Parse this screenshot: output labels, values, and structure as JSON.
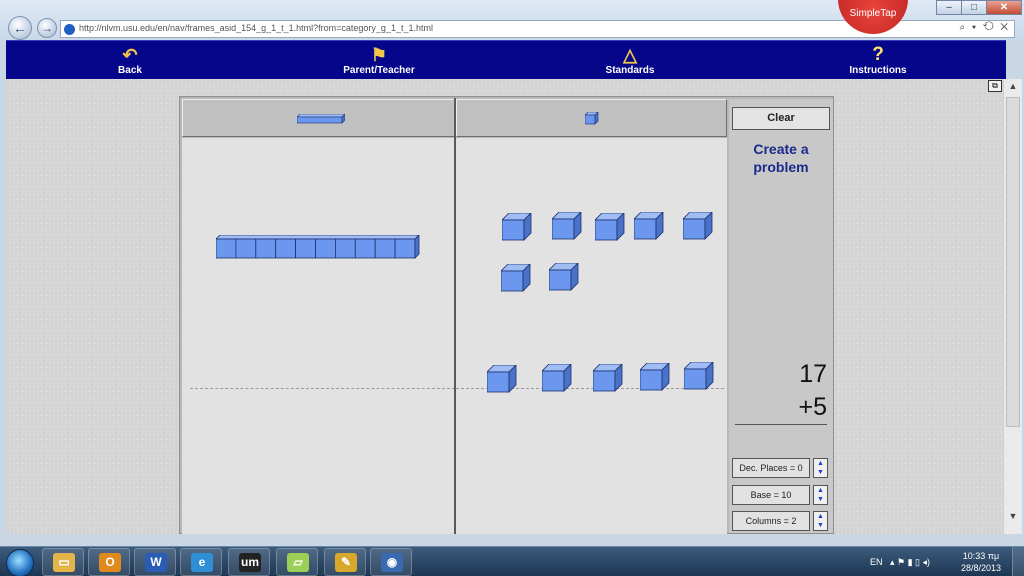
{
  "browser": {
    "url": "http://nlvm.usu.edu/en/nav/frames_asid_154_g_1_t_1.html?from=category_g_1_t_1.html",
    "toolbar_label": "SimpleTap",
    "url_tools": "⌕ ▾ ⟲ ✕",
    "window_controls": {
      "min": "–",
      "max": "□",
      "close": "✕"
    },
    "nav": {
      "back": "←",
      "forward": "→"
    }
  },
  "site_nav": {
    "back": {
      "label": "Back",
      "icon": "↶"
    },
    "parent_teacher": {
      "label": "Parent/Teacher",
      "icon": "⚑"
    },
    "standards": {
      "label": "Standards",
      "icon": "△"
    },
    "instructions": {
      "label": "Instructions",
      "icon": "?"
    }
  },
  "applet": {
    "clear_label": "Clear",
    "create_problem": "Create a problem",
    "addend1": "17",
    "addend2": "+5",
    "options": [
      {
        "label": "Dec. Places = 0"
      },
      {
        "label": "Base = 10"
      },
      {
        "label": "Columns = 2"
      }
    ],
    "stepper": {
      "up": "▲",
      "down": "▼"
    },
    "blocks": {
      "top_tens_rods": 1,
      "top_ones_cubes": 7,
      "bottom_ones_cubes": 5,
      "block_color": "#6b98ee",
      "block_edge": "#1c2f6e"
    }
  },
  "taskbar": {
    "apps": [
      {
        "name": "explorer",
        "glyph": "▭",
        "color": "#e3b54a"
      },
      {
        "name": "outlook",
        "glyph": "O",
        "color": "#e08a1e"
      },
      {
        "name": "word",
        "glyph": "W",
        "color": "#2a5bb5"
      },
      {
        "name": "internet-explorer",
        "glyph": "e",
        "color": "#2f8fd6"
      },
      {
        "name": "um",
        "glyph": "um",
        "color": "#222222"
      },
      {
        "name": "folder",
        "glyph": "▱",
        "color": "#9ccf55"
      },
      {
        "name": "paint",
        "glyph": "✎",
        "color": "#d7a82b"
      },
      {
        "name": "media",
        "glyph": "◉",
        "color": "#3a6ab0"
      }
    ],
    "language": "EN",
    "tray_icons": "▴ ⚑ ▮ ▯ ◂)",
    "time": "10:33 πμ",
    "date": "28/8/2013"
  }
}
